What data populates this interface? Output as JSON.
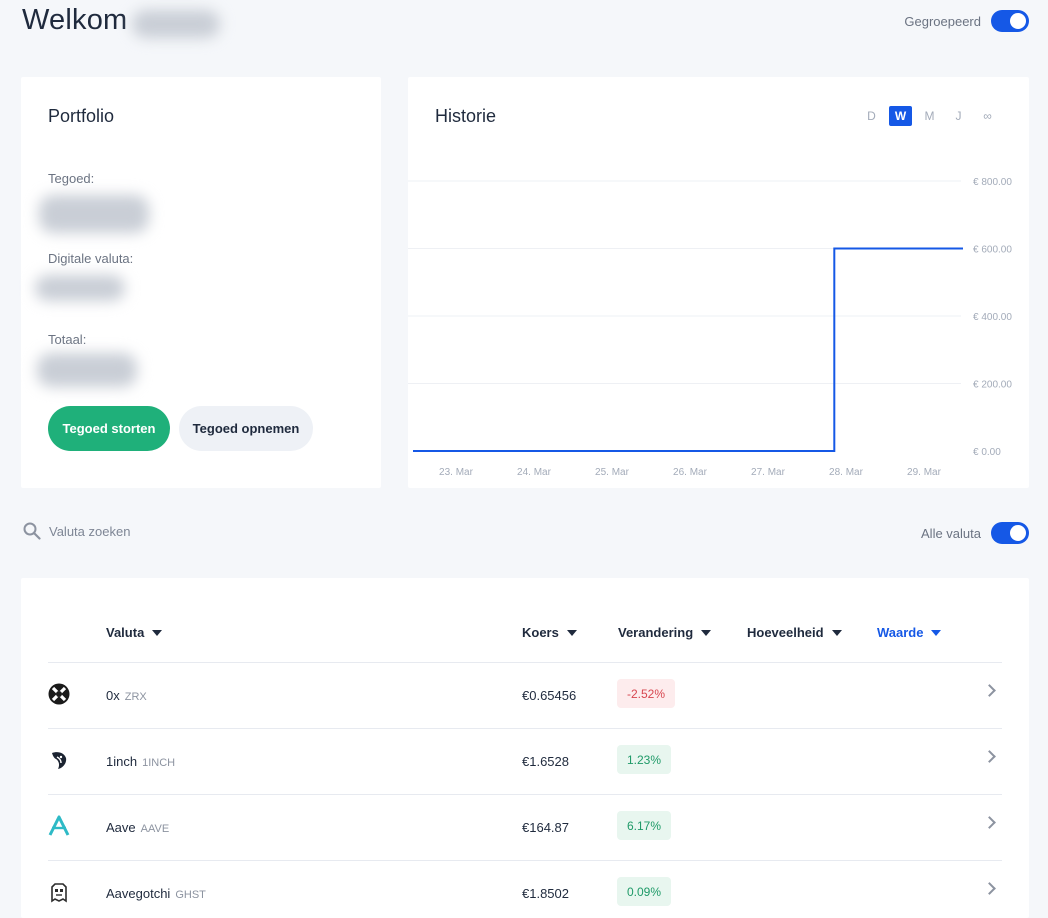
{
  "header": {
    "welcome": "Welkom",
    "grouped_label": "Gegroepeerd"
  },
  "portfolio": {
    "title": "Portfolio",
    "balance_label": "Tegoed:",
    "digital_label": "Digitale valuta:",
    "total_label": "Totaal:",
    "deposit_button": "Tegoed storten",
    "withdraw_button": "Tegoed opnemen"
  },
  "history": {
    "title": "Historie",
    "ranges": [
      "D",
      "W",
      "M",
      "J",
      "∞"
    ],
    "active_range": "W"
  },
  "chart_data": {
    "type": "line",
    "x": [
      "23. Mar",
      "24. Mar",
      "25. Mar",
      "26. Mar",
      "27. Mar",
      "28. Mar",
      "29. Mar"
    ],
    "points": [
      [
        0,
        0
      ],
      [
        4.85,
        0
      ],
      [
        4.85,
        600
      ],
      [
        6.5,
        600
      ]
    ],
    "y_ticks": [
      "€ 0.00",
      "€ 200.00",
      "€ 400.00",
      "€ 600.00",
      "€ 800.00"
    ],
    "ylim": [
      0,
      800
    ],
    "series_color": "#1558e6",
    "grid": true
  },
  "search": {
    "placeholder": "Valuta zoeken",
    "all_currencies_label": "Alle valuta"
  },
  "table": {
    "columns": {
      "currency": "Valuta",
      "rate": "Koers",
      "change": "Verandering",
      "amount": "Hoeveelheid",
      "value": "Waarde"
    },
    "sorted_by": "Waarde",
    "rows": [
      {
        "name": "0x",
        "symbol": "ZRX",
        "price": "€0.65456",
        "change": "-2.52%",
        "trend": "neg",
        "icon": "zrx-icon"
      },
      {
        "name": "1inch",
        "symbol": "1INCH",
        "price": "€1.6528",
        "change": "1.23%",
        "trend": "pos",
        "icon": "1inch-icon"
      },
      {
        "name": "Aave",
        "symbol": "AAVE",
        "price": "€164.87",
        "change": "6.17%",
        "trend": "pos",
        "icon": "aave-icon"
      },
      {
        "name": "Aavegotchi",
        "symbol": "GHST",
        "price": "€1.8502",
        "change": "0.09%",
        "trend": "pos",
        "icon": "ghst-icon"
      }
    ]
  },
  "colors": {
    "accent": "#1558e6",
    "success": "#1fb07a",
    "negative": "#d7464f"
  }
}
